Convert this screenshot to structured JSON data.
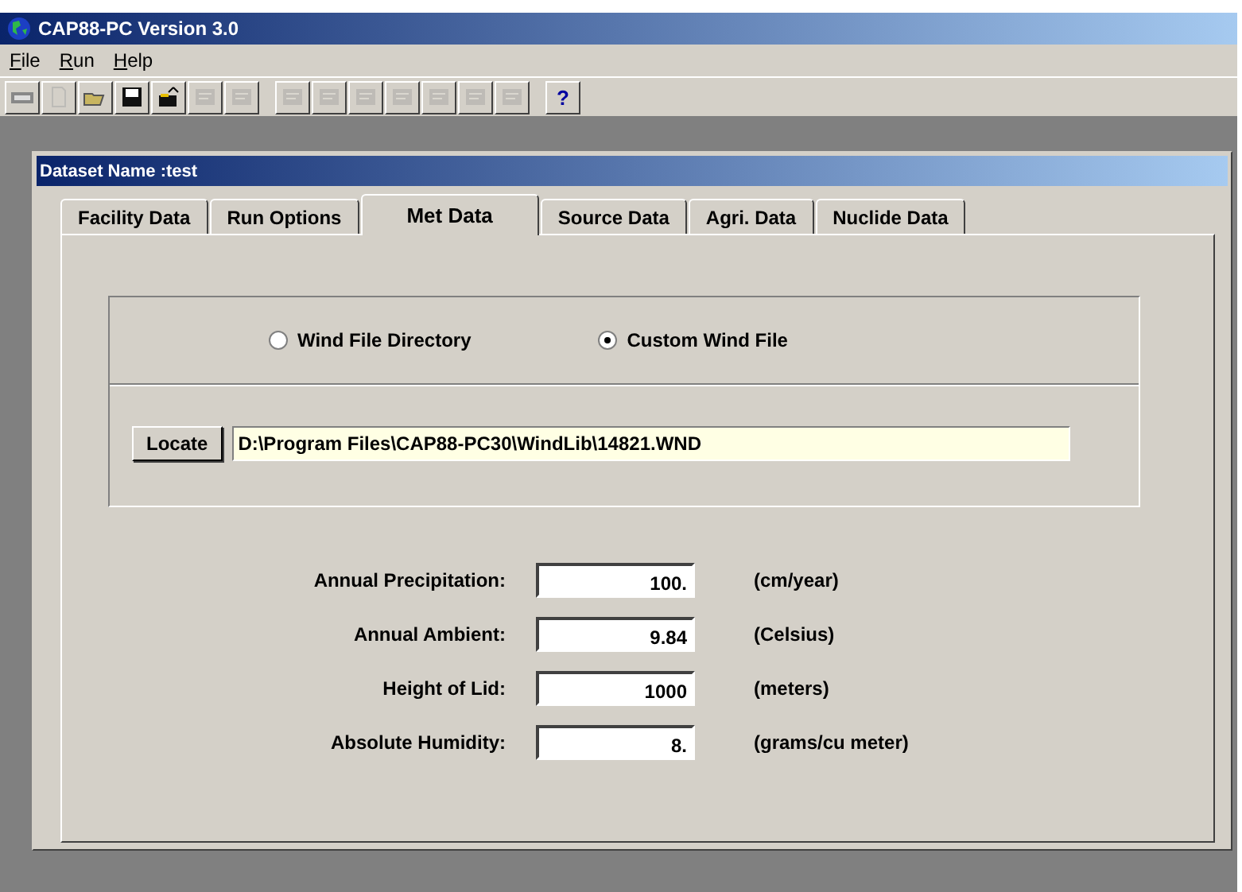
{
  "window": {
    "title": "CAP88-PC Version 3.0"
  },
  "menu": [
    "File",
    "Run",
    "Help"
  ],
  "toolbar": [
    {
      "disabled": false
    },
    {
      "disabled": true
    },
    {
      "disabled": false
    },
    {
      "disabled": false
    },
    {
      "disabled": false
    },
    {
      "disabled": true
    },
    {
      "disabled": true
    },
    {
      "disabled": true
    },
    {
      "disabled": true
    },
    {
      "disabled": true
    },
    {
      "disabled": true
    },
    {
      "disabled": true
    },
    {
      "disabled": true
    },
    {
      "disabled": true
    },
    {
      "disabled": false,
      "label": "?"
    }
  ],
  "child_window": {
    "title": "Dataset Name :test"
  },
  "tabs": [
    {
      "label": "Facility Data",
      "selected": false
    },
    {
      "label": "Run Options",
      "selected": false
    },
    {
      "label": "Met Data",
      "selected": true
    },
    {
      "label": "Source Data",
      "selected": false
    },
    {
      "label": "Agri. Data",
      "selected": false
    },
    {
      "label": "Nuclide Data",
      "selected": false
    }
  ],
  "wind_source": [
    {
      "label": "Wind File Directory",
      "selected": false
    },
    {
      "label": "Custom Wind File",
      "selected": true
    }
  ],
  "locate_button": "Locate",
  "wind_file_path": "D:\\Program Files\\CAP88-PC30\\WindLib\\14821.WND",
  "fields": [
    {
      "label": "Annual Precipitation:",
      "value": "100.",
      "unit": "(cm/year)"
    },
    {
      "label": "Annual Ambient:",
      "value": "9.84",
      "unit": "(Celsius)"
    },
    {
      "label": "Height of Lid:",
      "value": "1000",
      "unit": "(meters)"
    },
    {
      "label": "Absolute Humidity:",
      "value": "8.",
      "unit": "(grams/cu meter)"
    }
  ]
}
